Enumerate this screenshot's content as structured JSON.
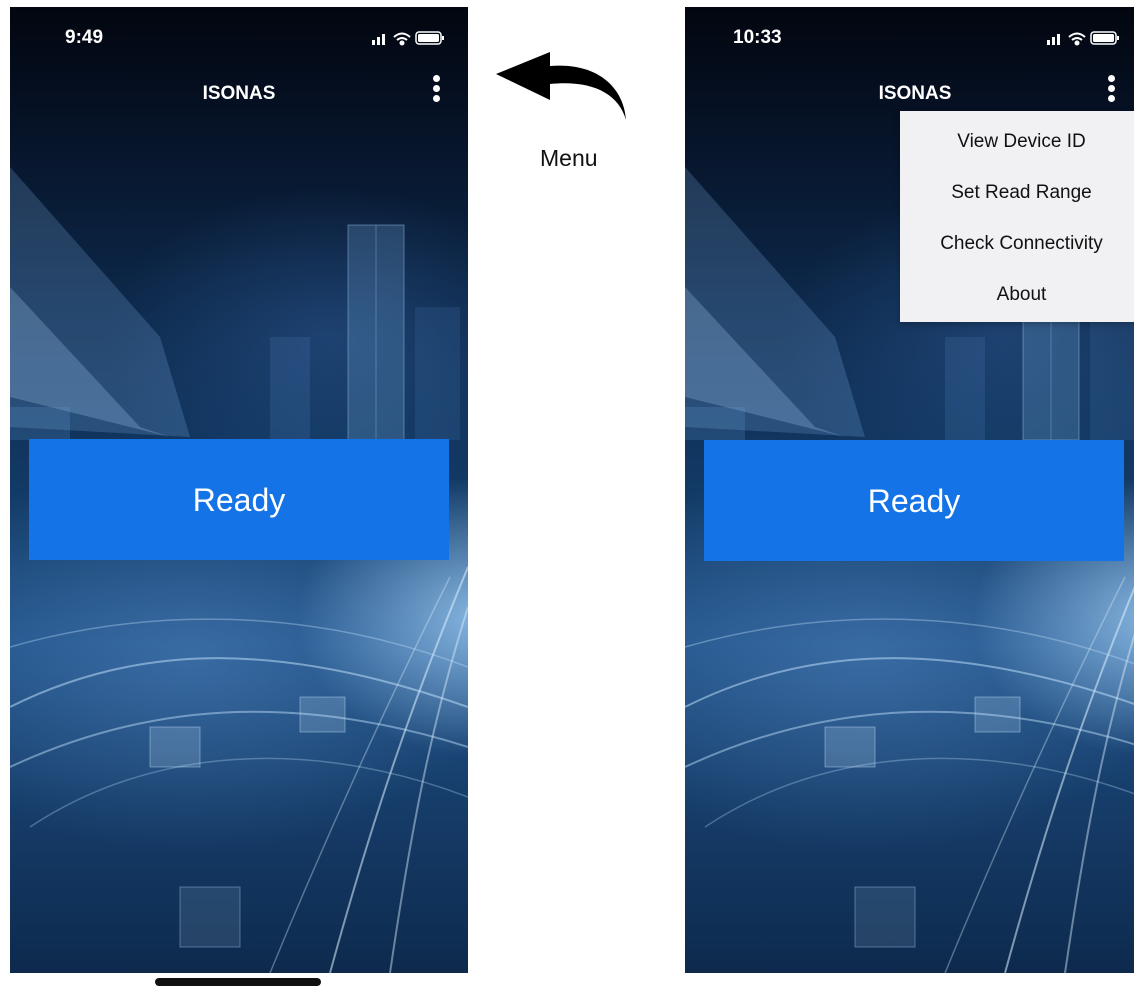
{
  "left_screen": {
    "status": {
      "time": "9:49",
      "icons": [
        "signal-icon",
        "wifi-icon",
        "battery-icon"
      ]
    },
    "nav": {
      "title": "ISONAS",
      "menu_icon": "more-vertical-icon"
    },
    "main": {
      "ready_label": "Ready"
    }
  },
  "right_screen": {
    "status": {
      "time": "10:33",
      "icons": [
        "signal-icon",
        "wifi-icon",
        "battery-icon"
      ]
    },
    "nav": {
      "title": "ISONAS",
      "menu_icon": "more-vertical-icon"
    },
    "menu": {
      "items": [
        {
          "label": "View Device ID"
        },
        {
          "label": "Set Read Range"
        },
        {
          "label": "Check Connectivity"
        },
        {
          "label": "About"
        }
      ]
    },
    "main": {
      "ready_label": "Ready"
    }
  },
  "callout": {
    "label": "Menu",
    "icon": "curved-arrow-left-icon"
  },
  "colors": {
    "ready_button": "#1473e6",
    "menu_background": "#f1f1f4",
    "background_dark": "#061226"
  }
}
